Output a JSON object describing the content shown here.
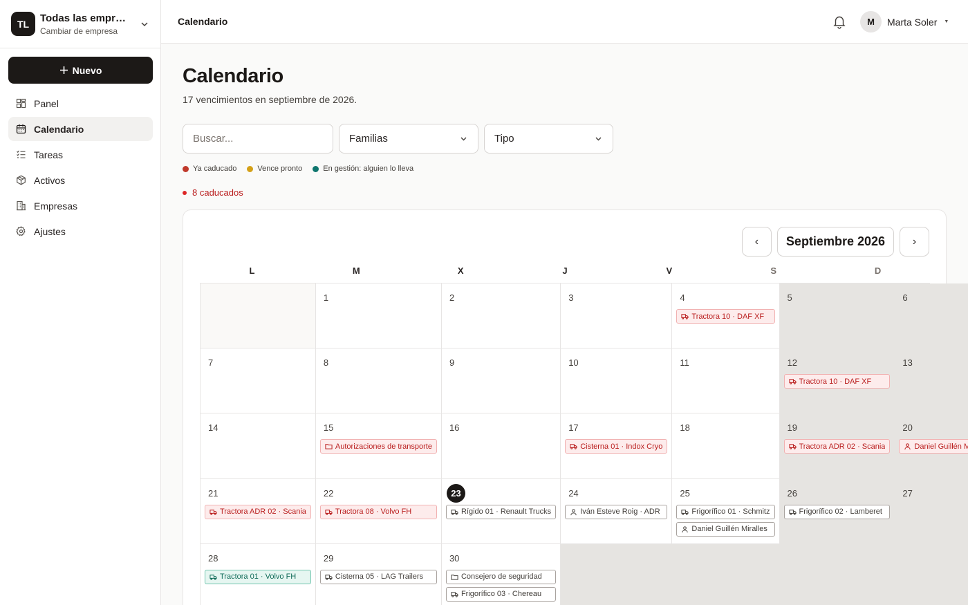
{
  "sidebar": {
    "logo": "TL",
    "company_name": "Todas las empresas",
    "company_sub": "Cambiar de empresa",
    "new_button": "Nuevo",
    "items": [
      {
        "label": "Panel",
        "icon": "grid-icon"
      },
      {
        "label": "Calendario",
        "icon": "calendar-icon",
        "active": true
      },
      {
        "label": "Tareas",
        "icon": "tasks-icon"
      },
      {
        "label": "Activos",
        "icon": "box-icon"
      },
      {
        "label": "Empresas",
        "icon": "building-icon"
      },
      {
        "label": "Ajustes",
        "icon": "gear-icon"
      }
    ]
  },
  "header": {
    "title": "Calendario",
    "user_initial": "M",
    "user_name": "Marta Soler"
  },
  "main": {
    "title": "Calendario",
    "subtitle": "17 vencimientos en septiembre de 2026.",
    "search_placeholder": "Buscar...",
    "filter_families": "Familias",
    "filter_type": "Tipo",
    "legend": [
      {
        "label": "Ya caducado",
        "color": "#c0392b"
      },
      {
        "label": "Vence pronto",
        "color": "#d4a017"
      },
      {
        "label": "En gestión: alguien lo lleva",
        "color": "#0f766e"
      }
    ],
    "overdue_text": "8 caducados",
    "month_label": "Septiembre 2026",
    "prev_label": "‹",
    "next_label": "›",
    "weekdays": [
      "L",
      "M",
      "X",
      "J",
      "V",
      "S",
      "D"
    ]
  },
  "calendar": {
    "today": 23,
    "weeks": [
      [
        {
          "day": null
        },
        {
          "day": 1,
          "events": []
        },
        {
          "day": 2,
          "events": []
        },
        {
          "day": 3,
          "events": []
        },
        {
          "day": 4,
          "events": [
            {
              "label": "Tractora 10 · DAF XF",
              "status": "red",
              "icon": "truck"
            }
          ]
        },
        {
          "day": 5,
          "events": [],
          "weekend": true
        },
        {
          "day": 6,
          "events": [],
          "weekend": true
        }
      ],
      [
        {
          "day": 7,
          "events": []
        },
        {
          "day": 8,
          "events": []
        },
        {
          "day": 9,
          "events": []
        },
        {
          "day": 10,
          "events": []
        },
        {
          "day": 11,
          "events": []
        },
        {
          "day": 12,
          "events": [
            {
              "label": "Tractora 10 · DAF XF",
              "status": "red",
              "icon": "truck"
            }
          ],
          "weekend": true
        },
        {
          "day": 13,
          "events": [],
          "weekend": true
        }
      ],
      [
        {
          "day": 14,
          "events": []
        },
        {
          "day": 15,
          "events": [
            {
              "label": "Autorizaciones de transporte",
              "status": "red",
              "icon": "folder"
            }
          ]
        },
        {
          "day": 16,
          "events": []
        },
        {
          "day": 17,
          "events": [
            {
              "label": "Cisterna 01 · Indox Cryo",
              "status": "red",
              "icon": "truck"
            }
          ]
        },
        {
          "day": 18,
          "events": []
        },
        {
          "day": 19,
          "events": [
            {
              "label": "Tractora ADR 02 · Scania",
              "status": "red",
              "icon": "truck"
            }
          ],
          "weekend": true
        },
        {
          "day": 20,
          "events": [
            {
              "label": "Daniel Guillén Miralles",
              "status": "red",
              "icon": "person"
            }
          ],
          "weekend": true
        }
      ],
      [
        {
          "day": 21,
          "events": [
            {
              "label": "Tractora ADR 02 · Scania",
              "status": "red",
              "icon": "truck"
            }
          ]
        },
        {
          "day": 22,
          "events": [
            {
              "label": "Tractora 08 · Volvo FH",
              "status": "red",
              "icon": "truck"
            }
          ]
        },
        {
          "day": 23,
          "events": [
            {
              "label": "Rígido 01 · Renault Trucks",
              "status": "neutral",
              "icon": "truck"
            }
          ]
        },
        {
          "day": 24,
          "events": [
            {
              "label": "Iván Esteve Roig · ADR",
              "status": "neutral",
              "icon": "person"
            }
          ]
        },
        {
          "day": 25,
          "events": [
            {
              "label": "Frigorífico 01 · Schmitz",
              "status": "neutral",
              "icon": "truck"
            },
            {
              "label": "Daniel Guillén Miralles",
              "status": "neutral",
              "icon": "person"
            }
          ]
        },
        {
          "day": 26,
          "events": [
            {
              "label": "Frigorífico 02 · Lamberet",
              "status": "neutral",
              "icon": "truck"
            }
          ],
          "weekend": true
        },
        {
          "day": 27,
          "events": [],
          "weekend": true
        }
      ],
      [
        {
          "day": 28,
          "events": [
            {
              "label": "Tractora 01 · Volvo FH",
              "status": "teal",
              "icon": "truck"
            }
          ]
        },
        {
          "day": 29,
          "events": [
            {
              "label": "Cisterna 05 · LAG Trailers",
              "status": "neutral",
              "icon": "truck"
            }
          ]
        },
        {
          "day": 30,
          "events": [
            {
              "label": "Consejero de seguridad",
              "status": "neutral",
              "icon": "folder"
            },
            {
              "label": "Frigorífico 03 · Chereau",
              "status": "neutral",
              "icon": "truck"
            }
          ]
        },
        {
          "day": null,
          "filler": true
        },
        {
          "day": null,
          "filler": true
        },
        {
          "day": null,
          "filler": true
        },
        {
          "day": null,
          "filler": true
        }
      ]
    ]
  }
}
